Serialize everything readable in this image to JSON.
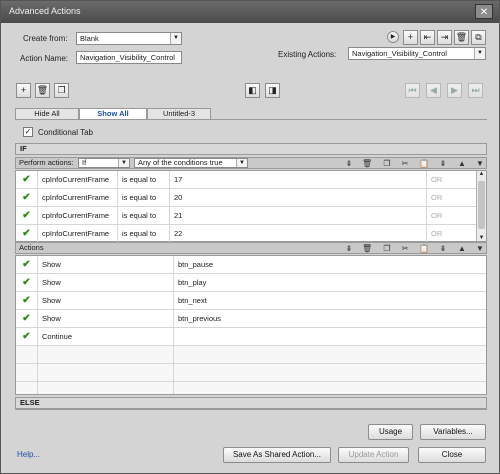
{
  "window": {
    "title": "Advanced Actions",
    "close_glyph": "✕"
  },
  "create_from": {
    "label": "Create from:",
    "value": "Blank"
  },
  "action_name": {
    "label": "Action Name:",
    "value": "Navigation_Visibility_Control"
  },
  "existing_actions": {
    "label": "Existing Actions:",
    "value": "Navigation_Visibility_Control"
  },
  "tabs": [
    {
      "label": "Hide All"
    },
    {
      "label": "Show All"
    },
    {
      "label": "Untitled-3"
    }
  ],
  "conditional_tab": {
    "label": "Conditional Tab",
    "checked": true
  },
  "if_section": {
    "label": "IF"
  },
  "perform": {
    "label": "Perform actions:",
    "mode": "If",
    "condition": "Any of the conditions true"
  },
  "conditions": [
    {
      "variable": "cpInfoCurrentFrame",
      "operator": "is equal to",
      "value": "17",
      "joiner": "OR"
    },
    {
      "variable": "cpInfoCurrentFrame",
      "operator": "is equal to",
      "value": "20",
      "joiner": "OR"
    },
    {
      "variable": "cpInfoCurrentFrame",
      "operator": "is equal to",
      "value": "21",
      "joiner": "OR"
    },
    {
      "variable": "cpInfoCurrentFrame",
      "operator": "is equal to",
      "value": "22",
      "joiner": "OR"
    }
  ],
  "actions_section": {
    "label": "Actions"
  },
  "actions": [
    {
      "action": "Show",
      "target": "btn_pause"
    },
    {
      "action": "Show",
      "target": "btn_play"
    },
    {
      "action": "Show",
      "target": "btn_next"
    },
    {
      "action": "Show",
      "target": "btn_previous"
    },
    {
      "action": "Continue",
      "target": ""
    }
  ],
  "else_section": {
    "label": "ELSE"
  },
  "buttons": {
    "usage": "Usage",
    "variables": "Variables...",
    "help": "Help...",
    "save_shared": "Save As Shared Action...",
    "update": "Update Action",
    "close": "Close"
  },
  "colors": {
    "check": "#2e8a16",
    "link": "#1f4fa8",
    "active_tab": "#1a4fa0"
  }
}
